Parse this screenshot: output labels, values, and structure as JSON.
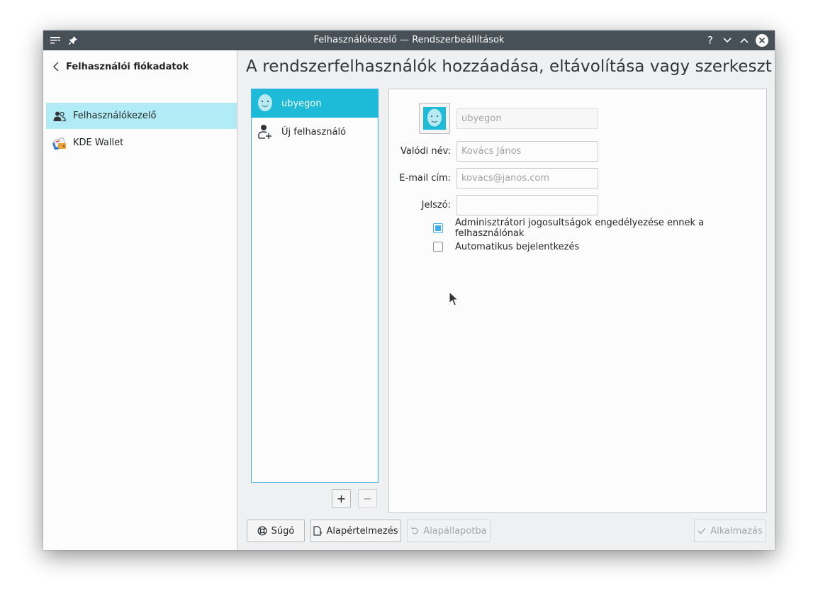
{
  "window": {
    "title": "Felhasználókezelő — Rendszerbeállítások"
  },
  "titlebar_icons": [
    "menu-icon",
    "pin-icon",
    "help-icon",
    "minimize-icon",
    "maximize-icon",
    "close-icon"
  ],
  "sidebar": {
    "back_label": "Felhasználói fiókadatok",
    "items": [
      {
        "label": "Felhasználókezelő",
        "icon": "users-icon",
        "active": true
      },
      {
        "label": "KDE Wallet",
        "icon": "kde-wallet-icon",
        "active": false
      }
    ]
  },
  "main": {
    "title": "A rendszerfelhasználók hozzáadása, eltávolítása vagy szerkeszt"
  },
  "user_list": {
    "items": [
      {
        "label": "ubyegon",
        "icon": "user-avatar-icon",
        "selected": true
      },
      {
        "label": "Új felhasználó",
        "icon": "add-user-icon",
        "selected": false
      }
    ],
    "add_label": "+",
    "remove_label": "−"
  },
  "details": {
    "username_placeholder": "ubyegon",
    "real_name": {
      "label": "Valódi név:",
      "placeholder": "Kovács János"
    },
    "email": {
      "label": "E-mail cím:",
      "placeholder": "kovacs@janos.com"
    },
    "password": {
      "label": "Jelszó:",
      "value": ""
    },
    "admin_checkbox": {
      "label": "Adminisztrátori jogosultságok engedélyezése ennek a felhasználónak",
      "checked": true
    },
    "autologin_checkbox": {
      "label": "Automatikus bejelentkezés",
      "checked": false
    }
  },
  "buttons": {
    "help": "Súgó",
    "defaults": "Alapértelmezés",
    "reset": "Alapállapotba",
    "apply": "Alkalmazás"
  },
  "colors": {
    "accent": "#3daee9",
    "selection": "#1ebbd8",
    "sidebar_active": "#b1ebf6",
    "titlebar": "#475057"
  }
}
